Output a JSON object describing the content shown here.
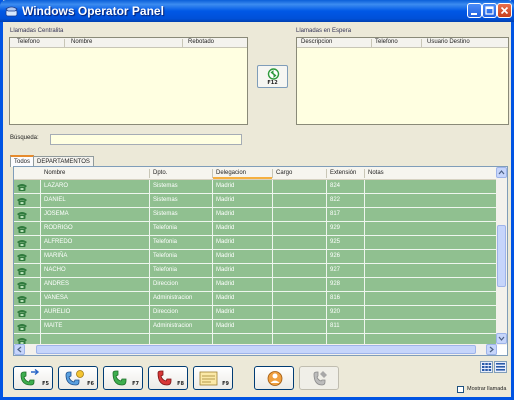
{
  "window": {
    "title": "Windows Operator Panel",
    "title_color": "#ffffff",
    "titlebar_color": "#0058e6"
  },
  "title_buttons": {
    "minimize_icon": "minimize-icon",
    "maximize_icon": "maximize-icon",
    "close_icon": "close-icon"
  },
  "centralita": {
    "label": "Llamadas Centralita",
    "columns": [
      "Telefono",
      "Nombre",
      "Rebotado"
    ]
  },
  "espera": {
    "label": "Llamadas en Espera",
    "columns": [
      "Descripcion",
      "Telefono",
      "Usuario Destino"
    ]
  },
  "transfer_button": {
    "key": "F12",
    "icon": "transfer-arrows-icon"
  },
  "search": {
    "label": "Búsqueda:",
    "value": ""
  },
  "tabs": [
    {
      "label": "Todos",
      "active": true
    },
    {
      "label": "DEPARTAMENTOS",
      "active": false
    }
  ],
  "grid": {
    "columns": [
      "Nombre",
      "Dpto.",
      "Delegacion",
      "Cargo",
      "Extensión",
      "Notas"
    ],
    "sorted_column": "Delegacion",
    "row_color": "#90c090",
    "rows": [
      {
        "nombre": "LAZARO",
        "dpto": "Sistemas",
        "delegacion": "Madrid",
        "cargo": "",
        "extension": "824",
        "notas": ""
      },
      {
        "nombre": "DANIEL",
        "dpto": "Sistemas",
        "delegacion": "Madrid",
        "cargo": "",
        "extension": "822",
        "notas": ""
      },
      {
        "nombre": "JOSEMA",
        "dpto": "Sistemas",
        "delegacion": "Madrid",
        "cargo": "",
        "extension": "817",
        "notas": ""
      },
      {
        "nombre": "RODRIGO",
        "dpto": "Telefonia",
        "delegacion": "Madrid",
        "cargo": "",
        "extension": "929",
        "notas": ""
      },
      {
        "nombre": "ALFREDO",
        "dpto": "Telefonia",
        "delegacion": "Madrid",
        "cargo": "",
        "extension": "925",
        "notas": ""
      },
      {
        "nombre": "MARIÑA",
        "dpto": "Telefonia",
        "delegacion": "Madrid",
        "cargo": "",
        "extension": "926",
        "notas": ""
      },
      {
        "nombre": "NACHO",
        "dpto": "Telefonia",
        "delegacion": "Madrid",
        "cargo": "",
        "extension": "927",
        "notas": ""
      },
      {
        "nombre": "ANDRES",
        "dpto": "Direccion",
        "delegacion": "Madrid",
        "cargo": "",
        "extension": "928",
        "notas": ""
      },
      {
        "nombre": "VANESA",
        "dpto": "Administracion",
        "delegacion": "Madrid",
        "cargo": "",
        "extension": "816",
        "notas": ""
      },
      {
        "nombre": "AURELIO",
        "dpto": "Direccion",
        "delegacion": "Madrid",
        "cargo": "",
        "extension": "920",
        "notas": ""
      },
      {
        "nombre": "MAITE",
        "dpto": "Administracion",
        "delegacion": "Madrid",
        "cargo": "",
        "extension": "811",
        "notas": ""
      },
      {
        "nombre": "",
        "dpto": "",
        "delegacion": "",
        "cargo": "",
        "extension": "",
        "notas": ""
      }
    ]
  },
  "function_buttons": [
    {
      "key": "F5",
      "icon": "phone-forward-icon"
    },
    {
      "key": "F6",
      "icon": "phone-transfer-icon"
    },
    {
      "key": "F7",
      "icon": "phone-answer-icon"
    },
    {
      "key": "F8",
      "icon": "phone-hangup-icon"
    },
    {
      "key": "F9",
      "icon": "memo-icon"
    }
  ],
  "extra_buttons": [
    {
      "icon": "user-config-icon",
      "enabled": true
    },
    {
      "icon": "phone-settings-icon",
      "enabled": false
    }
  ],
  "view_buttons": {
    "grid_icon": "grid-view-icon",
    "list_icon": "list-view-icon"
  },
  "show_calls": {
    "label": "Mostrar llamada",
    "checked": false
  }
}
